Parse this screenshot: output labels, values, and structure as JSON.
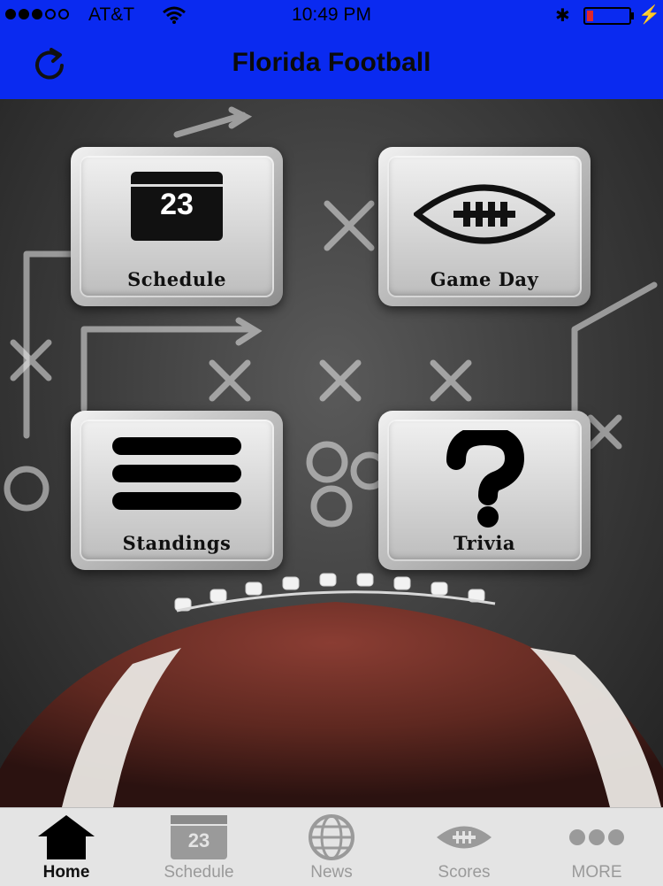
{
  "status_bar": {
    "carrier": "AT&T",
    "time": "10:49 PM",
    "signal_bars_filled": 3,
    "signal_bars_total": 5,
    "battery_level": 0.15,
    "icons": [
      "wifi-icon",
      "bluetooth-icon",
      "battery-icon",
      "charging-icon"
    ]
  },
  "nav": {
    "title": "Florida Football",
    "refresh_icon": "refresh-icon"
  },
  "tiles": {
    "schedule": {
      "label": "Schedule",
      "calendar_number": "23",
      "icon": "calendar-icon"
    },
    "game_day": {
      "label": "Game Day",
      "icon": "football-icon"
    },
    "standings": {
      "label": "Standings",
      "icon": "list-icon"
    },
    "trivia": {
      "label": "Trivia",
      "icon": "question-mark-icon"
    }
  },
  "tabbar": {
    "tabs": [
      {
        "label": "Home",
        "icon": "home-icon",
        "active": true
      },
      {
        "label": "Schedule",
        "icon": "calendar-icon",
        "number": "23",
        "active": false
      },
      {
        "label": "News",
        "icon": "globe-icon",
        "active": false
      },
      {
        "label": "Scores",
        "icon": "football-icon",
        "active": false
      },
      {
        "label": "MORE",
        "icon": "more-icon",
        "active": false
      }
    ]
  },
  "colors": {
    "nav_blue": "#0a2af0",
    "battery_red": "#e0262b",
    "tab_inactive": "#9a9a9a"
  }
}
